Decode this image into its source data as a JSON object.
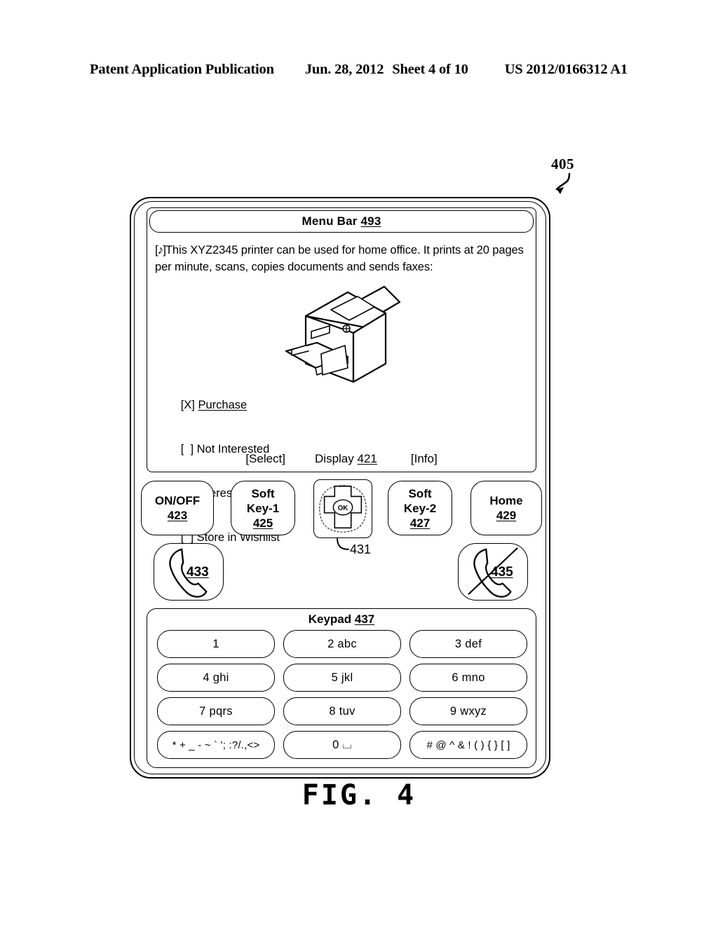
{
  "page_header": {
    "publication": "Patent Application Publication",
    "date": "Jun. 28, 2012",
    "sheet": "Sheet 4 of 10",
    "patent_number": "US 2012/0166312 A1"
  },
  "figure": {
    "caption": "FIG. 4",
    "device_reference": "405"
  },
  "device": {
    "display": {
      "menu_bar": {
        "label": "Menu Bar",
        "reference": "493"
      },
      "description": {
        "icon": "music-note-icon",
        "icon_glyph": "[♪]",
        "text": "This XYZ2345 printer can be used for home office. It prints at 20 pages per minute, scans, copies documents and sends faxes:"
      },
      "product_image": {
        "alt": "printer-illustration"
      },
      "options": [
        {
          "marker": "[X]",
          "label": "Purchase",
          "selected": true
        },
        {
          "marker": "[  ]",
          "label": "Not Interested",
          "selected": false
        },
        {
          "marker": "[  ]",
          "label": "Interested",
          "selected": false
        },
        {
          "marker": "[  ]",
          "label": "Store in Wishlist",
          "selected": false
        }
      ],
      "footer": {
        "left_softkey": "[Select]",
        "center_label": "Display",
        "center_reference": "421",
        "right_softkey": "[Info]"
      }
    },
    "controls": [
      {
        "name": "on-off",
        "line1": "ON/OFF",
        "line2": "",
        "reference": "423"
      },
      {
        "name": "soft-key-1",
        "line1": "Soft",
        "line2": "Key-1",
        "reference": "425"
      },
      {
        "name": "soft-key-2",
        "line1": "Soft",
        "line2": "Key-2",
        "reference": "427"
      },
      {
        "name": "home",
        "line1": "Home",
        "line2": "",
        "reference": "429"
      }
    ],
    "navigation_pad": {
      "center_label": "OK",
      "reference": "431"
    },
    "call_buttons": [
      {
        "name": "send-call",
        "icon": "phone-handset-icon",
        "reference": "433"
      },
      {
        "name": "end-call",
        "icon": "phone-handset-slashed-icon",
        "reference": "435"
      }
    ],
    "keypad": {
      "title": "Keypad",
      "reference": "437",
      "keys": [
        "1",
        "2 abc",
        "3 def",
        "4 ghi",
        "5 jkl",
        "6 mno",
        "7 pqrs",
        "8 tuv",
        "9 wxyz",
        "* + _ - ~ ` '; :?/.,<>",
        "0 ⌴",
        "# @ ^ & ! ( ) { } [ ]"
      ]
    }
  }
}
